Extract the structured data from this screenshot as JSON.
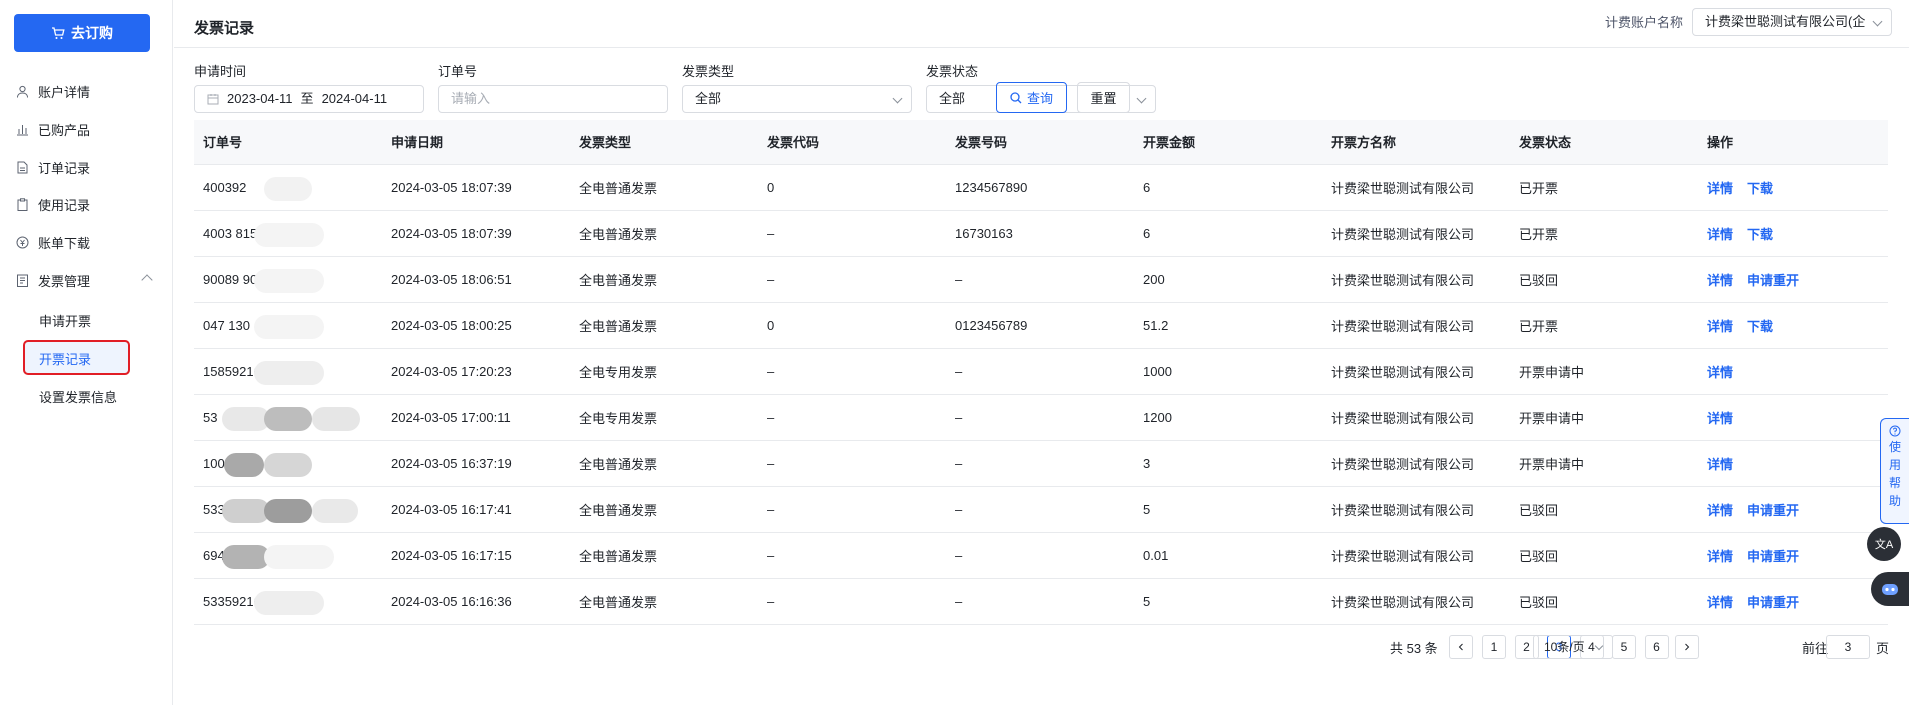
{
  "sidebar": {
    "buy_button": "去订购",
    "items": [
      {
        "label": "账户详情",
        "icon": "user-icon"
      },
      {
        "label": "已购产品",
        "icon": "chart-icon"
      },
      {
        "label": "订单记录",
        "icon": "document-icon"
      },
      {
        "label": "使用记录",
        "icon": "clipboard-icon"
      },
      {
        "label": "账单下载",
        "icon": "coin-icon"
      },
      {
        "label": "发票管理",
        "icon": "invoice-icon"
      }
    ],
    "sub_items": [
      "申请开票",
      "开票记录",
      "设置发票信息"
    ],
    "active_sub": "开票记录"
  },
  "header": {
    "title": "发票记录",
    "account_label": "计费账户名称",
    "account_value": "计费梁世聪测试有限公司(企"
  },
  "filters": {
    "date_label": "申请时间",
    "date_start": "2023-04-11",
    "date_sep": "至",
    "date_end": "2024-04-11",
    "order_label": "订单号",
    "order_placeholder": "请输入",
    "type_label": "发票类型",
    "type_value": "全部",
    "status_label": "发票状态",
    "status_value": "全部",
    "query_button": "查询",
    "reset_button": "重置"
  },
  "table": {
    "columns": [
      "订单号",
      "申请日期",
      "发票类型",
      "发票代码",
      "发票号码",
      "开票金额",
      "开票方名称",
      "发票状态",
      "操作"
    ],
    "rows": [
      {
        "order": "400392",
        "date": "2024-03-05 18:07:39",
        "type": "全电普通发票",
        "code": "0",
        "number": "1234567890",
        "amount": "6",
        "issuer": "计费梁世聪测试有限公司",
        "status": "已开票",
        "ops": [
          "详情",
          "下载"
        ]
      },
      {
        "order": "4003                    8156",
        "date": "2024-03-05 18:07:39",
        "type": "全电普通发票",
        "code": "–",
        "number": "16730163",
        "amount": "6",
        "issuer": "计费梁世聪测试有限公司",
        "status": "已开票",
        "ops": [
          "详情",
          "下载"
        ]
      },
      {
        "order": "90089                   90",
        "date": "2024-03-05 18:06:51",
        "type": "全电普通发票",
        "code": "–",
        "number": "–",
        "amount": "200",
        "issuer": "计费梁世聪测试有限公司",
        "status": "已驳回",
        "ops": [
          "详情",
          "申请重开"
        ]
      },
      {
        "order": "047                     130",
        "date": "2024-03-05 18:00:25",
        "type": "全电普通发票",
        "code": "0",
        "number": "0123456789",
        "amount": "51.2",
        "issuer": "计费梁世聪测试有限公司",
        "status": "已开票",
        "ops": [
          "详情",
          "下载"
        ]
      },
      {
        "order": "15859216                08",
        "date": "2024-03-05 17:20:23",
        "type": "全电专用发票",
        "code": "–",
        "number": "–",
        "amount": "1000",
        "issuer": "计费梁世聪测试有限公司",
        "status": "开票申请中",
        "ops": [
          "详情"
        ]
      },
      {
        "order": "53",
        "date": "2024-03-05 17:00:11",
        "type": "全电专用发票",
        "code": "–",
        "number": "–",
        "amount": "1200",
        "issuer": "计费梁世聪测试有限公司",
        "status": "开票申请中",
        "ops": [
          "详情"
        ]
      },
      {
        "order": "1005                    342",
        "date": "2024-03-05 16:37:19",
        "type": "全电普通发票",
        "code": "–",
        "number": "–",
        "amount": "3",
        "issuer": "计费梁世聪测试有限公司",
        "status": "开票申请中",
        "ops": [
          "详情"
        ]
      },
      {
        "order": "533",
        "date": "2024-03-05 16:17:41",
        "type": "全电普通发票",
        "code": "–",
        "number": "–",
        "amount": "5",
        "issuer": "计费梁世聪测试有限公司",
        "status": "已驳回",
        "ops": [
          "详情",
          "申请重开"
        ]
      },
      {
        "order": "694                     44",
        "date": "2024-03-05 16:17:15",
        "type": "全电普通发票",
        "code": "–",
        "number": "–",
        "amount": "0.01",
        "issuer": "计费梁世聪测试有限公司",
        "status": "已驳回",
        "ops": [
          "详情",
          "申请重开"
        ]
      },
      {
        "order": "53359216                517",
        "date": "2024-03-05 16:16:36",
        "type": "全电普通发票",
        "code": "–",
        "number": "–",
        "amount": "5",
        "issuer": "计费梁世聪测试有限公司",
        "status": "已驳回",
        "ops": [
          "详情",
          "申请重开"
        ]
      }
    ]
  },
  "pagination": {
    "total_text": "共 53 条",
    "pages": [
      "1",
      "2",
      "3",
      "4",
      "5",
      "6"
    ],
    "current": "3",
    "page_size": "10条/页",
    "goto_prefix": "前往",
    "goto_value": "3",
    "goto_suffix": "页"
  },
  "floating": {
    "help_chars": [
      "使",
      "用",
      "帮",
      "助"
    ],
    "translate_label": "文A"
  },
  "colors": {
    "accent": "#2468f2",
    "highlight_border": "#e11e26"
  }
}
